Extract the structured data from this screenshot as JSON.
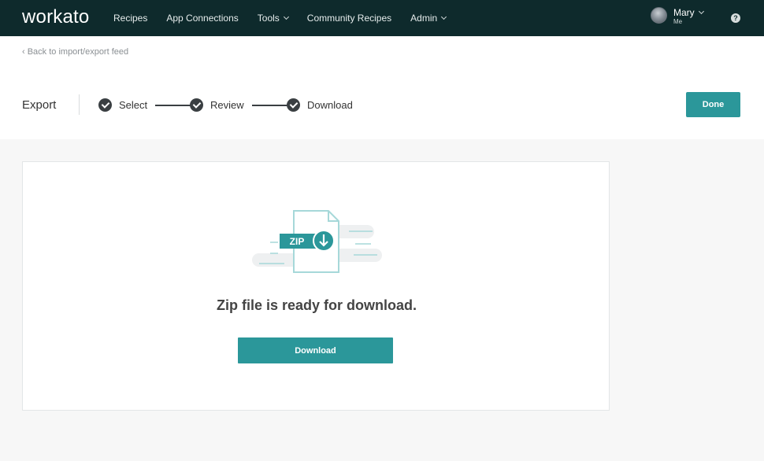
{
  "nav": {
    "logo": "workato",
    "items": [
      {
        "label": "Recipes",
        "has_dropdown": false
      },
      {
        "label": "App Connections",
        "has_dropdown": false
      },
      {
        "label": "Tools",
        "has_dropdown": true
      },
      {
        "label": "Community Recipes",
        "has_dropdown": false
      },
      {
        "label": "Admin",
        "has_dropdown": true
      }
    ],
    "user": {
      "name": "Mary",
      "sub": "Me"
    },
    "help_icon": "?"
  },
  "header": {
    "back_link": "‹ Back to import/export feed",
    "title": "Export",
    "steps": [
      {
        "label": "Select",
        "status": "complete"
      },
      {
        "label": "Review",
        "status": "complete"
      },
      {
        "label": "Download",
        "status": "complete"
      }
    ],
    "done_label": "Done"
  },
  "card": {
    "zip_label": "ZIP",
    "message": "Zip file is ready for download.",
    "download_label": "Download"
  },
  "colors": {
    "nav_bg": "#0e2a2c",
    "accent": "#2b979a",
    "step": "#3a3f42"
  }
}
